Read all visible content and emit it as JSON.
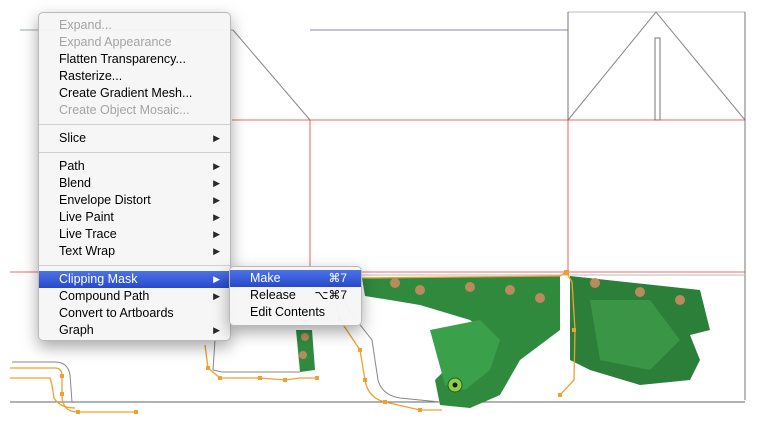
{
  "main_menu": {
    "items": [
      {
        "label": "Expand...",
        "disabled": true
      },
      {
        "label": "Expand Appearance",
        "disabled": true
      },
      {
        "label": "Flatten Transparency...",
        "disabled": false
      },
      {
        "label": "Rasterize...",
        "disabled": false
      },
      {
        "label": "Create Gradient Mesh...",
        "disabled": false
      },
      {
        "label": "Create Object Mosaic...",
        "disabled": true
      },
      {
        "label": "Slice",
        "submenu": true
      },
      {
        "label": "Path",
        "submenu": true
      },
      {
        "label": "Blend",
        "submenu": true
      },
      {
        "label": "Envelope Distort",
        "submenu": true
      },
      {
        "label": "Live Paint",
        "submenu": true
      },
      {
        "label": "Live Trace",
        "submenu": true
      },
      {
        "label": "Text Wrap",
        "submenu": true
      },
      {
        "label": "Clipping Mask",
        "submenu": true,
        "highlighted": true
      },
      {
        "label": "Compound Path",
        "submenu": true
      },
      {
        "label": "Convert to Artboards",
        "submenu": false
      },
      {
        "label": "Graph",
        "submenu": true
      }
    ],
    "arrow_glyph": "▶"
  },
  "submenu": {
    "items": [
      {
        "label": "Make",
        "shortcut": "⌘7",
        "highlighted": true
      },
      {
        "label": "Release",
        "shortcut": "⌥⌘7"
      },
      {
        "label": "Edit Contents",
        "shortcut": ""
      }
    ]
  },
  "colors": {
    "highlight": "#2f55d4",
    "guide_line": "#e23a3a",
    "path_anchor": "#f0a030",
    "frog_green": "#2f8a3e"
  }
}
